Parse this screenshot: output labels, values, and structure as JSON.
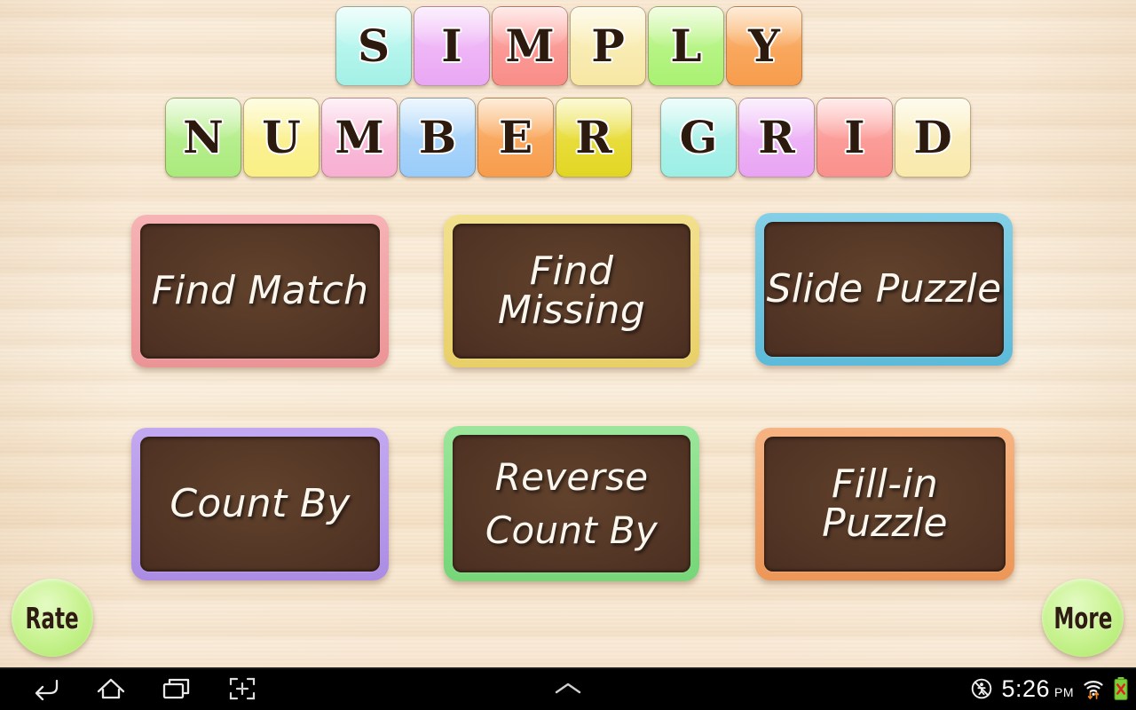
{
  "app": {
    "title_line1": "SIMPLY",
    "title_line2_a": "NUMBER",
    "title_line2_b": "GRID",
    "background_color": "#f7e6cf"
  },
  "title_tiles": {
    "row1": [
      {
        "letter": "S",
        "color": "#b7f6ee",
        "palette": "t-aqua"
      },
      {
        "letter": "I",
        "color": "#efb6f7",
        "palette": "t-violet"
      },
      {
        "letter": "M",
        "color": "#fb9a96",
        "palette": "t-salmon"
      },
      {
        "letter": "P",
        "color": "#f9ecb4",
        "palette": "t-cream"
      },
      {
        "letter": "L",
        "color": "#b7f486",
        "palette": "t-lime"
      },
      {
        "letter": "Y",
        "color": "#f9a85f",
        "palette": "t-orange"
      }
    ],
    "row2": [
      {
        "letter": "N",
        "color": "#b6ee8e",
        "palette": "t-green"
      },
      {
        "letter": "U",
        "color": "#fbf194",
        "palette": "t-yellow"
      },
      {
        "letter": "M",
        "color": "#f9bcd9",
        "palette": "t-pink"
      },
      {
        "letter": "B",
        "color": "#a9d4fa",
        "palette": "t-blue"
      },
      {
        "letter": "E",
        "color": "#f9a85f",
        "palette": "t-orange"
      },
      {
        "letter": "R",
        "color": "#e8dc3a",
        "palette": "t-gold"
      },
      {
        "letter": "G",
        "color": "#abf1e9",
        "palette": "t-cyan"
      },
      {
        "letter": "R",
        "color": "#edb3f6",
        "palette": "t-orchid"
      },
      {
        "letter": "I",
        "color": "#fb9d99",
        "palette": "t-rose"
      },
      {
        "letter": "D",
        "color": "#faedbb",
        "palette": "t-vanilla"
      }
    ]
  },
  "menu": {
    "buttons": [
      {
        "label": "Find Match",
        "frame_color": "#f2a3a6"
      },
      {
        "label": "Find Missing",
        "frame_color": "#efd97c"
      },
      {
        "label": "Slide Puzzle",
        "frame_color": "#6ec5e0"
      },
      {
        "label": "Count By",
        "frame_color": "#b79aea"
      },
      {
        "label": "Reverse\nCount By",
        "frame_color": "#87df88"
      },
      {
        "label": "Fill-in Puzzle",
        "frame_color": "#f2a46c"
      }
    ]
  },
  "corner_buttons": {
    "rate": {
      "label": "Rate",
      "color": "#b8ed78"
    },
    "more": {
      "label": "More",
      "color": "#b8ed78"
    }
  },
  "navbar": {
    "back_icon": "back-arrow-icon",
    "home_icon": "home-icon",
    "recents_icon": "recent-apps-icon",
    "screenshot_icon": "screenshot-icon",
    "expand_icon": "chevron-up-icon",
    "mute_icon": "silent-mode-icon",
    "wifi_icon": "wifi-icon",
    "battery_icon": "battery-error-icon",
    "time": "5:26",
    "ampm": "PM"
  }
}
